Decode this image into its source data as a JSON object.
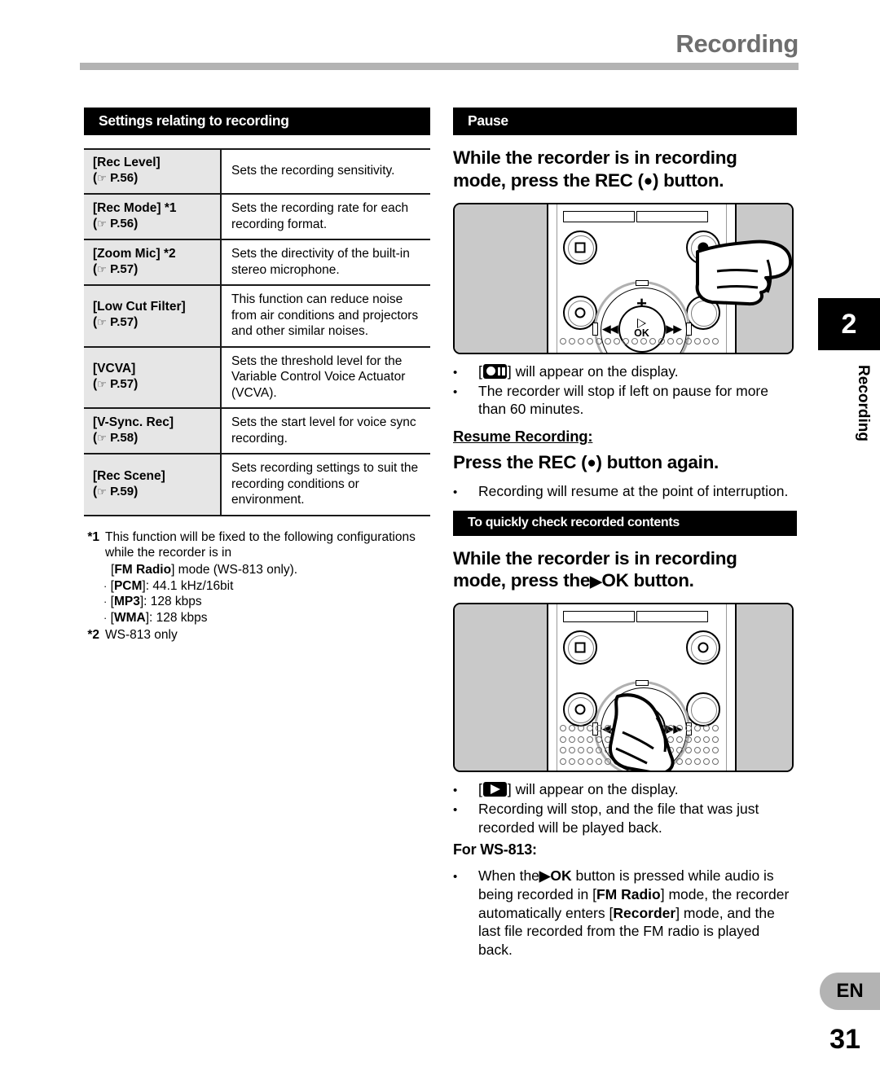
{
  "header": {
    "title": "Recording"
  },
  "left_column": {
    "section_title": "Settings relating to recording",
    "table": {
      "rows": [
        {
          "key": "[Rec Level]",
          "page_ref": "P.56",
          "value": "Sets the recording sensitivity."
        },
        {
          "key": "[Rec Mode] *1",
          "page_ref": "P.56",
          "value": "Sets the recording rate for each recording format."
        },
        {
          "key": "[Zoom Mic] *2",
          "page_ref": "P.57",
          "value": "Sets the directivity of the built-in stereo microphone."
        },
        {
          "key": "[Low Cut Filter]",
          "page_ref": "P.57",
          "value": "This function can reduce noise from air conditions and projectors and other similar noises."
        },
        {
          "key": "[VCVA]",
          "page_ref": "P.57",
          "value": "Sets the threshold level for the Variable Control Voice Actuator (VCVA)."
        },
        {
          "key": "[V-Sync. Rec]",
          "page_ref": "P.58",
          "value": "Sets the start level for voice sync recording."
        },
        {
          "key": "[Rec Scene]",
          "page_ref": "P.59",
          "value": "Sets recording settings to suit the recording conditions or environment."
        }
      ]
    },
    "footnotes": {
      "fn1_mark": "*1",
      "fn1_text": "This function will be fixed to the following configurations while the recorder is in",
      "fn1_mode_prefix": "[",
      "fn1_mode_bold": "FM Radio",
      "fn1_mode_suffix": "] mode (WS-813 only).",
      "fn1_items": [
        {
          "bullet": "·",
          "open": "[",
          "bold": "PCM",
          "close": "]",
          "rest": ": 44.1 kHz/16bit"
        },
        {
          "bullet": "·",
          "open": "[",
          "bold": "MP3",
          "close": "]",
          "rest": ": 128 kbps"
        },
        {
          "bullet": "·",
          "open": "[",
          "bold": "WMA",
          "close": "]",
          "rest": ": 128 kbps"
        }
      ],
      "fn2_mark": "*2",
      "fn2_text": "WS-813 only"
    }
  },
  "right_column": {
    "pause_section": {
      "section_title": "Pause",
      "instruction_line1": "While the recorder is in recording",
      "instruction_line2_a": "mode, press the REC (",
      "instruction_rec_symbol": "●",
      "instruction_line2_b": ") button.",
      "device_alt": "voice recorder front panel with hand pressing REC button",
      "notes": [
        {
          "icon": "pause-record-display-icon",
          "text_after": "] will appear on the display.",
          "text_before": "["
        },
        {
          "icon": null,
          "text": "The recorder will stop if left on pause for more than 60 minutes."
        }
      ],
      "resume_heading": "Resume Recording:",
      "resume_instruction_a": "Press the REC (",
      "resume_rec_symbol": "●",
      "resume_instruction_b": ") button again.",
      "resume_notes": [
        {
          "text": "Recording will resume at the point of interruption."
        }
      ]
    },
    "check_section": {
      "section_title": "To quickly check recorded contents",
      "instruction_line1": "While the recorder is in recording",
      "instruction_line2_a": "mode, press the",
      "instruction_play_symbol": "▶",
      "instruction_line2_b": "OK button.",
      "device_alt": "voice recorder front panel with hand pressing play OK button",
      "notes": [
        {
          "icon": "play-display-icon",
          "text_before": "[",
          "text_after": "] will appear on the display."
        },
        {
          "icon": null,
          "text": "Recording will stop, and the file that was just recorded will be played back."
        }
      ],
      "for_heading": "For WS-813:",
      "final_note": {
        "p1": "When the",
        "play_symbol": "▶",
        "p2": "OK",
        "p3": " button is pressed while audio is being recorded in [",
        "bold1": "FM Radio",
        "p4": "] mode, the recorder automatically enters [",
        "bold2": "Recorder",
        "p5": "] mode, and the last file recorded from the FM radio is played back."
      }
    }
  },
  "margin": {
    "chapter_number": "2",
    "chapter_label": "Recording"
  },
  "footer": {
    "language": "EN",
    "page_number": "31"
  },
  "device_glyphs": {
    "stop": "square-stop-icon",
    "record": "record-circle-icon",
    "erase": "erase-circle-icon",
    "plus": "+",
    "minus": "–",
    "rew": "◀◀",
    "ff": "▶▶",
    "ok": "OK"
  },
  "colors": {
    "header_rule": "#b3b3b3",
    "header_title": "#6e6e6e",
    "section_bar": "#000000",
    "table_key_bg": "#e6e6e6",
    "device_side": "#c9c9c9",
    "lang_badge": "#b3b3b3"
  }
}
